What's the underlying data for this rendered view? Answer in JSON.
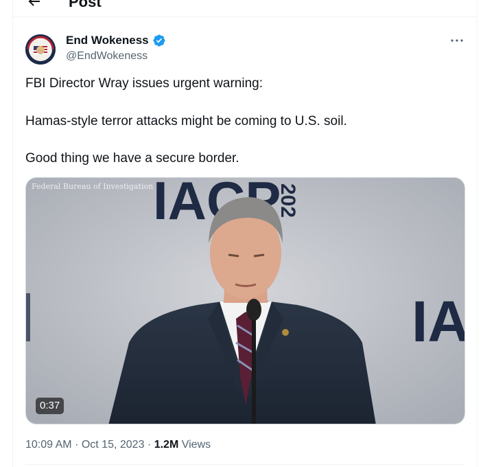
{
  "header": {
    "title": "Post",
    "back_icon": "arrow-left-icon"
  },
  "post": {
    "author": {
      "name": "End Wokeness",
      "handle": "@EndWokeness",
      "verified_color": "#1d9bf0"
    },
    "more_icon": "more-horizontal-icon",
    "text_lines": [
      "FBI Director Wray issues urgent warning:",
      "Hamas-style terror attacks might be coming to U.S. soil.",
      "Good thing we have a secure border."
    ],
    "media": {
      "caption": "Federal Bureau of Investigation",
      "duration": "0:37",
      "backdrop_text_top": "IACP",
      "backdrop_text_side": "IA",
      "backdrop_year": "202"
    },
    "meta": {
      "time": "10:09 AM",
      "separator": "·",
      "date": "Oct 15, 2023",
      "views_count": "1.2M",
      "views_label": "Views"
    }
  }
}
